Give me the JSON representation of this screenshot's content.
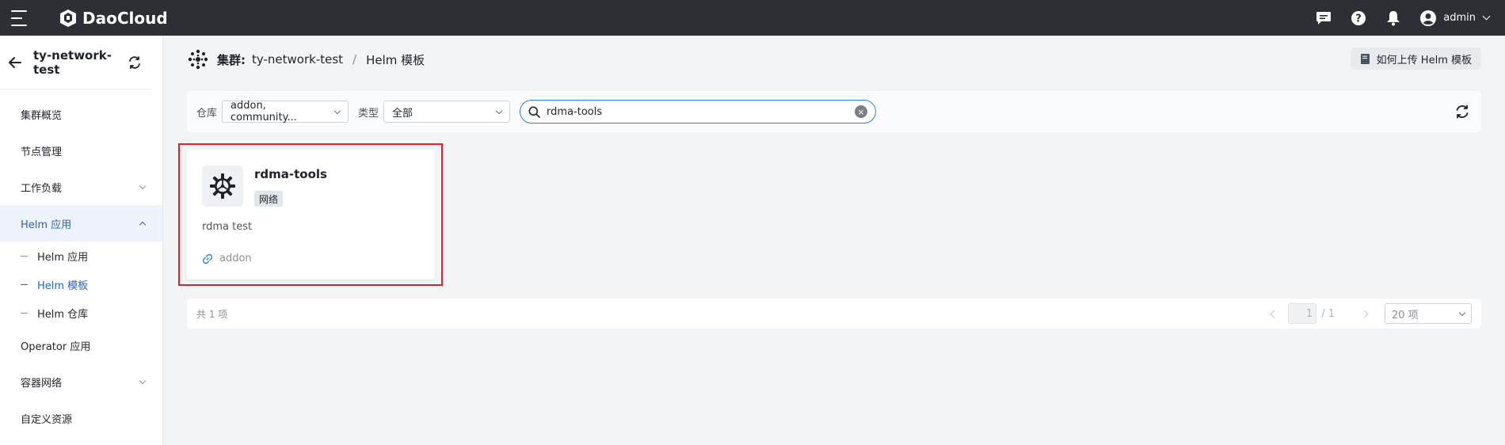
{
  "topbar": {
    "brand": "DaoCloud",
    "user": "admin",
    "icons": [
      "menu-icon",
      "message-icon",
      "help-icon",
      "bell-icon",
      "user-avatar-icon"
    ]
  },
  "sidebar": {
    "cluster": "ty-network-test",
    "items": [
      {
        "label": "集群概览"
      },
      {
        "label": "节点管理"
      },
      {
        "label": "工作负载"
      },
      {
        "label": "Helm 应用"
      },
      {
        "label": "Operator 应用"
      },
      {
        "label": "容器网络"
      },
      {
        "label": "自定义资源"
      }
    ],
    "subitems": [
      {
        "label": "Helm 应用"
      },
      {
        "label": "Helm 模板"
      },
      {
        "label": "Helm 仓库"
      }
    ]
  },
  "breadcrumb": {
    "label": "集群:",
    "cluster": "ty-network-test",
    "sep": "/",
    "page": "Helm 模板"
  },
  "help_button": "如何上传 Helm 模板",
  "filters": {
    "repo_label": "仓库",
    "repo_value": "addon, community...",
    "type_label": "类型",
    "type_value": "全部",
    "search_value": "rdma-tools",
    "clear": "×"
  },
  "card": {
    "title": "rdma-tools",
    "tag": "网络",
    "description": "rdma test",
    "repo": "addon"
  },
  "pager": {
    "total": "共 1 项",
    "page_current": "1",
    "page_total": "/ 1",
    "page_size": "20 项"
  },
  "colors": {
    "accent": "#2563c9",
    "topbar": "#2c2f34",
    "highlight": "#e0202a"
  }
}
